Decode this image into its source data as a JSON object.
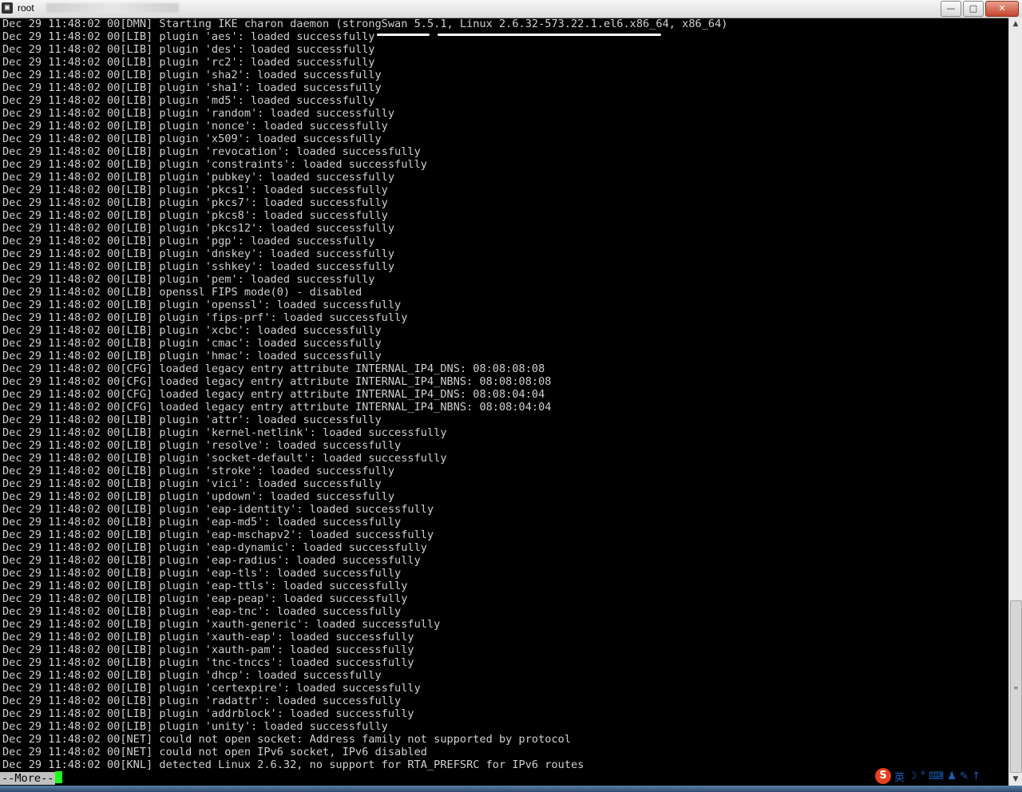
{
  "window": {
    "title": "root",
    "buttons": {
      "minimize": "—",
      "maximize": "□",
      "close": "✕"
    }
  },
  "terminal": {
    "lines": [
      "Dec 29 11:48:02 00[DMN] Starting IKE charon daemon (strongSwan 5.5.1, Linux 2.6.32-573.22.1.el6.x86_64, x86_64)",
      "Dec 29 11:48:02 00[LIB] plugin 'aes': loaded successfully",
      "Dec 29 11:48:02 00[LIB] plugin 'des': loaded successfully",
      "Dec 29 11:48:02 00[LIB] plugin 'rc2': loaded successfully",
      "Dec 29 11:48:02 00[LIB] plugin 'sha2': loaded successfully",
      "Dec 29 11:48:02 00[LIB] plugin 'sha1': loaded successfully",
      "Dec 29 11:48:02 00[LIB] plugin 'md5': loaded successfully",
      "Dec 29 11:48:02 00[LIB] plugin 'random': loaded successfully",
      "Dec 29 11:48:02 00[LIB] plugin 'nonce': loaded successfully",
      "Dec 29 11:48:02 00[LIB] plugin 'x509': loaded successfully",
      "Dec 29 11:48:02 00[LIB] plugin 'revocation': loaded successfully",
      "Dec 29 11:48:02 00[LIB] plugin 'constraints': loaded successfully",
      "Dec 29 11:48:02 00[LIB] plugin 'pubkey': loaded successfully",
      "Dec 29 11:48:02 00[LIB] plugin 'pkcs1': loaded successfully",
      "Dec 29 11:48:02 00[LIB] plugin 'pkcs7': loaded successfully",
      "Dec 29 11:48:02 00[LIB] plugin 'pkcs8': loaded successfully",
      "Dec 29 11:48:02 00[LIB] plugin 'pkcs12': loaded successfully",
      "Dec 29 11:48:02 00[LIB] plugin 'pgp': loaded successfully",
      "Dec 29 11:48:02 00[LIB] plugin 'dnskey': loaded successfully",
      "Dec 29 11:48:02 00[LIB] plugin 'sshkey': loaded successfully",
      "Dec 29 11:48:02 00[LIB] plugin 'pem': loaded successfully",
      "Dec 29 11:48:02 00[LIB] openssl FIPS mode(0) - disabled",
      "Dec 29 11:48:02 00[LIB] plugin 'openssl': loaded successfully",
      "Dec 29 11:48:02 00[LIB] plugin 'fips-prf': loaded successfully",
      "Dec 29 11:48:02 00[LIB] plugin 'xcbc': loaded successfully",
      "Dec 29 11:48:02 00[LIB] plugin 'cmac': loaded successfully",
      "Dec 29 11:48:02 00[LIB] plugin 'hmac': loaded successfully",
      "Dec 29 11:48:02 00[CFG] loaded legacy entry attribute INTERNAL_IP4_DNS: 08:08:08:08",
      "Dec 29 11:48:02 00[CFG] loaded legacy entry attribute INTERNAL_IP4_NBNS: 08:08:08:08",
      "Dec 29 11:48:02 00[CFG] loaded legacy entry attribute INTERNAL_IP4_DNS: 08:08:04:04",
      "Dec 29 11:48:02 00[CFG] loaded legacy entry attribute INTERNAL_IP4_NBNS: 08:08:04:04",
      "Dec 29 11:48:02 00[LIB] plugin 'attr': loaded successfully",
      "Dec 29 11:48:02 00[LIB] plugin 'kernel-netlink': loaded successfully",
      "Dec 29 11:48:02 00[LIB] plugin 'resolve': loaded successfully",
      "Dec 29 11:48:02 00[LIB] plugin 'socket-default': loaded successfully",
      "Dec 29 11:48:02 00[LIB] plugin 'stroke': loaded successfully",
      "Dec 29 11:48:02 00[LIB] plugin 'vici': loaded successfully",
      "Dec 29 11:48:02 00[LIB] plugin 'updown': loaded successfully",
      "Dec 29 11:48:02 00[LIB] plugin 'eap-identity': loaded successfully",
      "Dec 29 11:48:02 00[LIB] plugin 'eap-md5': loaded successfully",
      "Dec 29 11:48:02 00[LIB] plugin 'eap-mschapv2': loaded successfully",
      "Dec 29 11:48:02 00[LIB] plugin 'eap-dynamic': loaded successfully",
      "Dec 29 11:48:02 00[LIB] plugin 'eap-radius': loaded successfully",
      "Dec 29 11:48:02 00[LIB] plugin 'eap-tls': loaded successfully",
      "Dec 29 11:48:02 00[LIB] plugin 'eap-ttls': loaded successfully",
      "Dec 29 11:48:02 00[LIB] plugin 'eap-peap': loaded successfully",
      "Dec 29 11:48:02 00[LIB] plugin 'eap-tnc': loaded successfully",
      "Dec 29 11:48:02 00[LIB] plugin 'xauth-generic': loaded successfully",
      "Dec 29 11:48:02 00[LIB] plugin 'xauth-eap': loaded successfully",
      "Dec 29 11:48:02 00[LIB] plugin 'xauth-pam': loaded successfully",
      "Dec 29 11:48:02 00[LIB] plugin 'tnc-tnccs': loaded successfully",
      "Dec 29 11:48:02 00[LIB] plugin 'dhcp': loaded successfully",
      "Dec 29 11:48:02 00[LIB] plugin 'certexpire': loaded successfully",
      "Dec 29 11:48:02 00[LIB] plugin 'radattr': loaded successfully",
      "Dec 29 11:48:02 00[LIB] plugin 'addrblock': loaded successfully",
      "Dec 29 11:48:02 00[LIB] plugin 'unity': loaded successfully",
      "Dec 29 11:48:02 00[NET] could not open socket: Address family not supported by protocol",
      "Dec 29 11:48:02 00[NET] could not open IPv6 socket, IPv6 disabled",
      "Dec 29 11:48:02 00[KNL] detected Linux 2.6.32, no support for RTA_PREFSRC for IPv6 routes"
    ],
    "more_prompt": "--More--"
  },
  "ime": {
    "logo": "S",
    "lang": "英",
    "icons": "☽ ° ⌨ ♟ ✎ ↑"
  },
  "colors": {
    "background": "#000000",
    "text": "#d0d0d0",
    "cursor": "#1aff1a"
  }
}
